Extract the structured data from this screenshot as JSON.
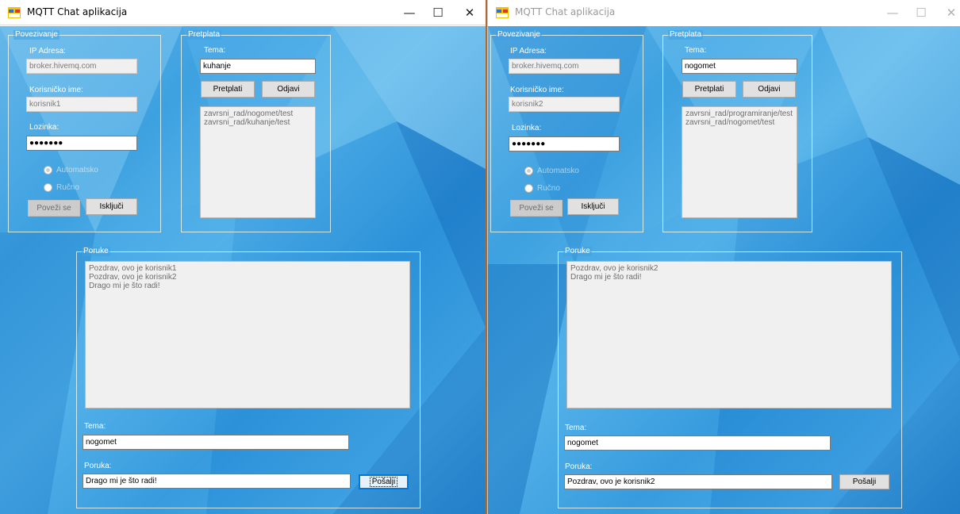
{
  "windows": [
    {
      "title": "MQTT Chat aplikacija",
      "active": true,
      "connection": {
        "group_title": "Povezivanje",
        "ip_label": "IP Adresa:",
        "ip_value": "broker.hivemq.com",
        "username_label": "Korisničko ime:",
        "username_value": "korisnik1",
        "password_label": "Lozinka:",
        "password_value": "●●●●●●●",
        "radio_auto": "Automatsko",
        "radio_manual": "Ručno",
        "connect_button": "Poveži se",
        "disconnect_button": "Isključi"
      },
      "subscription": {
        "group_title": "Pretplata",
        "topic_label": "Tema:",
        "topic_value": "kuhanje",
        "subscribe_button": "Pretplati",
        "unsubscribe_button": "Odjavi",
        "topics": [
          "zavrsni_rad/nogomet/test",
          "zavrsni_rad/kuhanje/test"
        ]
      },
      "messages": {
        "group_title": "Poruke",
        "items": [
          "Pozdrav, ovo je korisnik1",
          "Pozdrav, ovo je korisnik2",
          "Drago mi je što radi!"
        ],
        "topic_label": "Tema:",
        "topic_value": "nogomet",
        "message_label": "Poruka:",
        "message_value": "Drago mi je što radi!",
        "send_button": "Pošalji"
      }
    },
    {
      "title": "MQTT Chat aplikacija",
      "active": false,
      "connection": {
        "group_title": "Povezivanje",
        "ip_label": "IP Adresa:",
        "ip_value": "broker.hivemq.com",
        "username_label": "Korisničko ime:",
        "username_value": "korisnik2",
        "password_label": "Lozinka:",
        "password_value": "●●●●●●●",
        "radio_auto": "Automatsko",
        "radio_manual": "Ručno",
        "connect_button": "Poveži se",
        "disconnect_button": "Isključi"
      },
      "subscription": {
        "group_title": "Pretplata",
        "topic_label": "Tema:",
        "topic_value": "nogomet",
        "subscribe_button": "Pretplati",
        "unsubscribe_button": "Odjavi",
        "topics": [
          "zavrsni_rad/programiranje/test",
          "zavrsni_rad/nogomet/test"
        ]
      },
      "messages": {
        "group_title": "Poruke",
        "items": [
          "Pozdrav, ovo je korisnik2",
          "Drago mi je što radi!"
        ],
        "topic_label": "Tema:",
        "topic_value": "nogomet",
        "message_label": "Poruka:",
        "message_value": "Pozdrav, ovo je korisnik2",
        "send_button": "Pošalji"
      }
    }
  ],
  "window_controls": {
    "minimize": "—",
    "maximize": "☐",
    "close": "✕"
  },
  "icons": {
    "app": "app-window-icon",
    "radio": "radio-button"
  },
  "colors": {
    "background_blue": "#3da1e0",
    "focus_blue": "#0078d7",
    "divider": "#b06b2c"
  }
}
